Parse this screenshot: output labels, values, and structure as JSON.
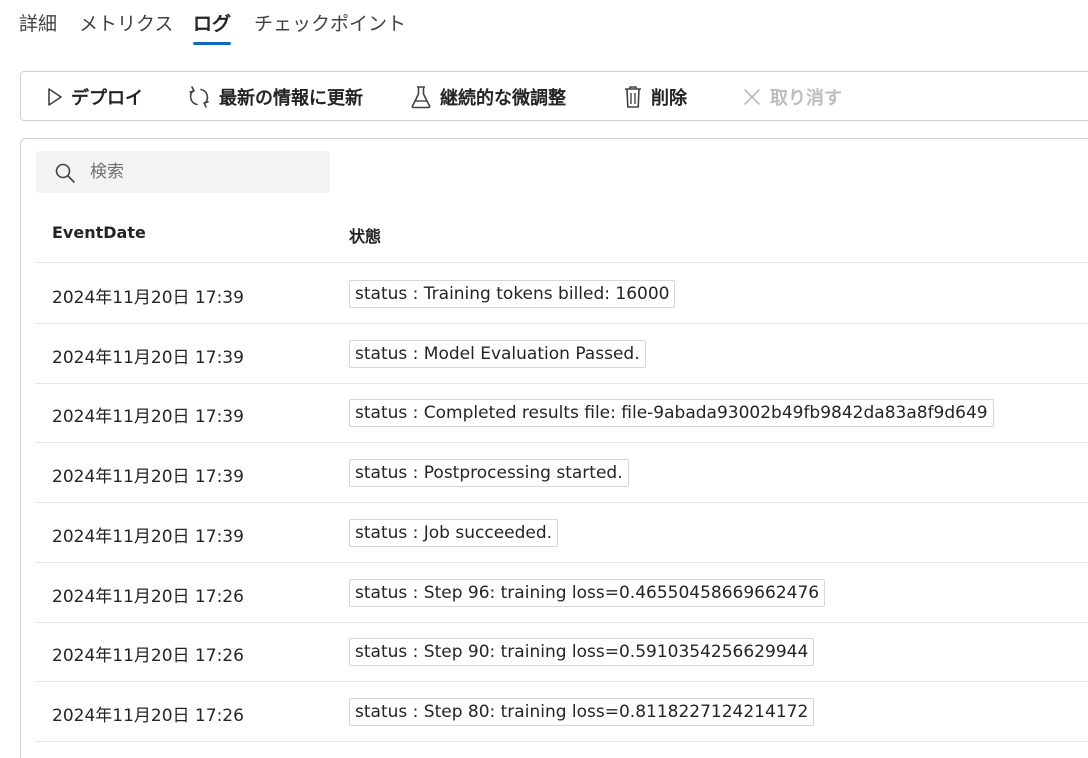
{
  "tabs": [
    {
      "label": "詳細"
    },
    {
      "label": "メトリクス"
    },
    {
      "label": "ログ",
      "active": true
    },
    {
      "label": "チェックポイント"
    }
  ],
  "toolbar": {
    "deploy_label": "デプロイ",
    "refresh_label": "最新の情報に更新",
    "finetune_label": "継続的な微調整",
    "delete_label": "削除",
    "cancel_label": "取り消す"
  },
  "search": {
    "placeholder": "検索",
    "value": ""
  },
  "table": {
    "columns": [
      "EventDate",
      "状態"
    ],
    "rows": [
      {
        "date": "2024年11月20日 17:39",
        "status": "status : Training tokens billed: 16000"
      },
      {
        "date": "2024年11月20日 17:39",
        "status": "status : Model Evaluation Passed."
      },
      {
        "date": "2024年11月20日 17:39",
        "status": "status : Completed results file: file-9abada93002b49fb9842da83a8f9d649"
      },
      {
        "date": "2024年11月20日 17:39",
        "status": "status : Postprocessing started."
      },
      {
        "date": "2024年11月20日 17:39",
        "status": "status : Job succeeded."
      },
      {
        "date": "2024年11月20日 17:26",
        "status": "status : Step 96: training loss=0.46550458669662476"
      },
      {
        "date": "2024年11月20日 17:26",
        "status": "status : Step 90: training loss=0.5910354256629944"
      },
      {
        "date": "2024年11月20日 17:26",
        "status": "status : Step 80: training loss=0.8118227124214172"
      }
    ]
  },
  "colors": {
    "accent": "#0f6cbd",
    "border": "#d1d1d1",
    "disabled": "#bdbdbd"
  }
}
